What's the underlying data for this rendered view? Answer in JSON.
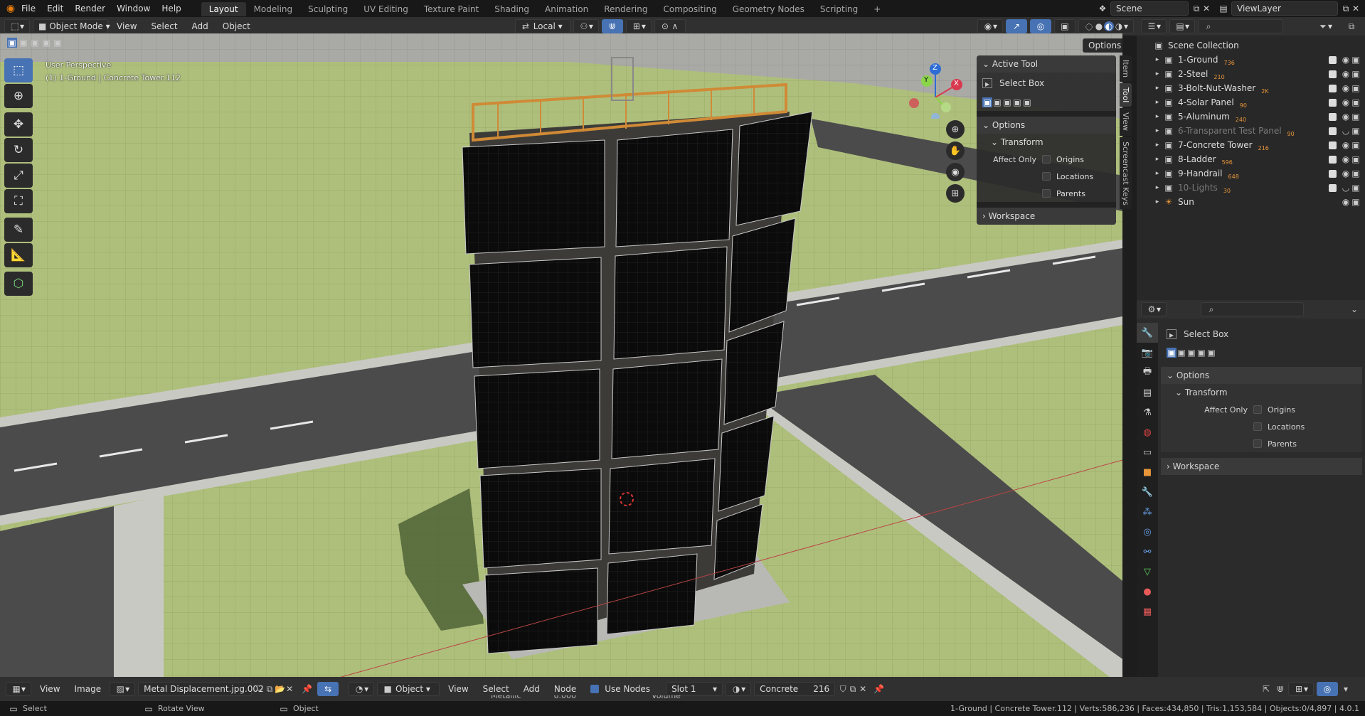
{
  "topbar": {
    "menus": [
      "File",
      "Edit",
      "Render",
      "Window",
      "Help"
    ],
    "workspaces": [
      "Layout",
      "Modeling",
      "Sculpting",
      "UV Editing",
      "Texture Paint",
      "Shading",
      "Animation",
      "Rendering",
      "Compositing",
      "Geometry Nodes",
      "Scripting"
    ],
    "active_workspace": "Layout",
    "add_tab_label": "+",
    "scene": "Scene",
    "view_layer": "ViewLayer"
  },
  "viewport_header": {
    "mode": "Object Mode",
    "menus": [
      "View",
      "Select",
      "Add",
      "Object"
    ],
    "orientation": "Local",
    "options_label": "Options"
  },
  "viewport": {
    "perspective": "User Perspective",
    "object_info": "(1) 1-Ground | Concrete Tower.112",
    "gizmo_axes": [
      "X",
      "Y",
      "Z"
    ]
  },
  "npanel": {
    "active_tool_title": "Active Tool",
    "tool_name": "Select Box",
    "options_title": "Options",
    "transform_title": "Transform",
    "affect_only_label": "Affect Only",
    "checks": [
      "Origins",
      "Locations",
      "Parents"
    ],
    "workspace_title": "Workspace",
    "tabs": [
      "Item",
      "Tool",
      "View",
      "Screencast Keys"
    ]
  },
  "outliner": {
    "root": "Scene Collection",
    "items": [
      {
        "name": "1-Ground",
        "count": "736",
        "dim": false
      },
      {
        "name": "2-Steel",
        "count": "210",
        "dim": false
      },
      {
        "name": "3-Bolt-Nut-Washer",
        "count": "2K",
        "dim": false
      },
      {
        "name": "4-Solar Panel",
        "count": "90",
        "dim": false
      },
      {
        "name": "5-Aluminum",
        "count": "240",
        "dim": false
      },
      {
        "name": "6-Transparent Test Panel",
        "count": "90",
        "dim": true
      },
      {
        "name": "7-Concrete Tower",
        "count": "216",
        "dim": false
      },
      {
        "name": "8-Ladder",
        "count": "596",
        "dim": false
      },
      {
        "name": "9-Handrail",
        "count": "648",
        "dim": false
      },
      {
        "name": "10-Lights",
        "count": "30",
        "dim": true
      },
      {
        "name": "Sun",
        "count": "",
        "dim": false
      }
    ]
  },
  "properties": {
    "tool_name": "Select Box",
    "options_title": "Options",
    "transform_title": "Transform",
    "affect_only_label": "Affect Only",
    "checks": [
      "Origins",
      "Locations",
      "Parents"
    ],
    "workspace_title": "Workspace"
  },
  "bottom_header": {
    "view": "View",
    "image": "Image",
    "image_name": "Metal Displacement.jpg.002",
    "object_label": "Object",
    "menus": [
      "View",
      "Select",
      "Add",
      "Node"
    ],
    "use_nodes": "Use Nodes",
    "slot": "Slot 1",
    "material": "Concrete",
    "users": "216",
    "metallic_label": "Metallic",
    "metallic_value": "0.000",
    "volume_label": "Volume"
  },
  "statusbar": {
    "select": "Select",
    "rotate": "Rotate View",
    "object": "Object",
    "stats": "1-Ground | Concrete Tower.112 | Verts:586,236 | Faces:434,850 | Tris:1,153,584 | Objects:0/4,897 | 4.0.1"
  },
  "colors": {
    "accent": "#4772b3",
    "ground": "#a8bd78",
    "road": "#4a4a4a",
    "panel": "#0d0d0d",
    "handrail": "#d08a36"
  }
}
